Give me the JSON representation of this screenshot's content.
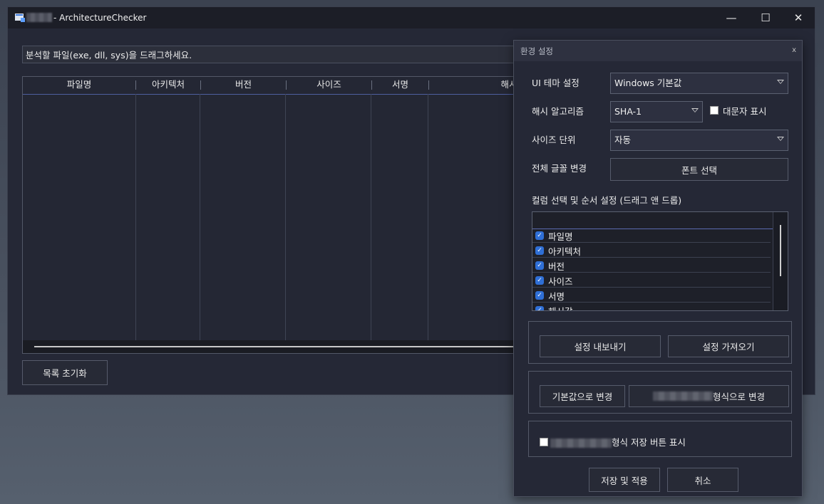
{
  "window": {
    "title": "- ArchitectureChecker",
    "controls": {
      "minimize": "—",
      "maximize": "☐",
      "close": "✕"
    }
  },
  "main": {
    "drop_hint": "분석할 파일(exe, dll, sys)을 드래그하세요.",
    "columns": [
      "파일명",
      "아키텍처",
      "버전",
      "사이즈",
      "서명",
      "해시"
    ],
    "reset_button": "목록 초기화"
  },
  "settings": {
    "title": "환경 설정",
    "close": "x",
    "theme_label": "UI 테마 설정",
    "theme_value": "Windows 기본값",
    "hash_label": "해시 알고리즘",
    "hash_value": "SHA-1",
    "uppercase_label": "대문자 표시",
    "uppercase_checked": false,
    "size_unit_label": "사이즈 단위",
    "size_unit_value": "자동",
    "font_label": "전체 글꼴 변경",
    "font_button": "폰트 선택",
    "columns_label": "컬럼 선택 및 순서 설정 (드래그 앤 드롭)",
    "columns_list": [
      {
        "label": "파일명",
        "checked": true
      },
      {
        "label": "아키텍처",
        "checked": true
      },
      {
        "label": "버전",
        "checked": true
      },
      {
        "label": "사이즈",
        "checked": true
      },
      {
        "label": "서명",
        "checked": true
      },
      {
        "label": "해시값",
        "checked": true
      }
    ],
    "export_button": "설정 내보내기",
    "import_button": "설정 가져오기",
    "default_button": "기본값으로 변경",
    "format_button_suffix": "형식으로 변경",
    "format_save_suffix": "형식 저장 버튼 표시",
    "format_save_checked": false,
    "save_button": "저장 및 적용",
    "cancel_button": "취소"
  }
}
